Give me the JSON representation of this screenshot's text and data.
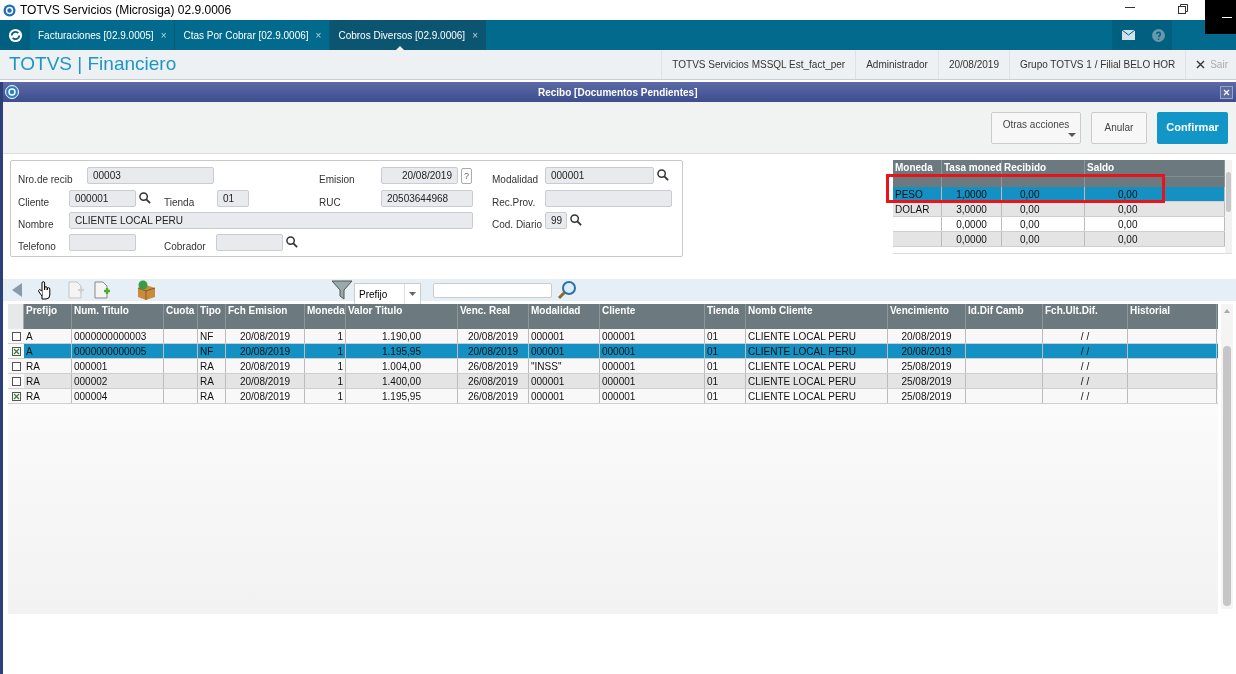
{
  "window": {
    "title": "TOTVS Servicios (Microsiga) 02.9.0006"
  },
  "tabs": [
    {
      "label": "Facturaciones [02.9.0005]",
      "close": "×",
      "selected": false
    },
    {
      "label": "Ctas Por Cobrar [02.9.0006]",
      "close": "×",
      "selected": false
    },
    {
      "label": "Cobros Diversos [02.9.0006]",
      "close": "×",
      "selected": true
    }
  ],
  "header": {
    "brand": "TOTVS | Financiero",
    "info": [
      "TOTVS Servicios MSSQL Est_fact_per",
      "Administrador",
      "20/08/2019",
      "Grupo TOTVS 1 / Filial BELO HOR"
    ],
    "exit": "Sair"
  },
  "dialog": {
    "title": "Recibo [Documentos Pendientes]",
    "buttons": [
      {
        "label": "Otras acciones",
        "kind": "menu"
      },
      {
        "label": "Anular",
        "kind": "plain"
      },
      {
        "label": "Confirmar",
        "kind": "primary"
      }
    ]
  },
  "form": {
    "fields": [
      {
        "label": "Nro.de recib",
        "value": "00003",
        "lookup": false
      },
      {
        "label": "Emision",
        "value": "20/08/2019",
        "help": "?",
        "lookup": false
      },
      {
        "label": "Modalidad",
        "value": "000001",
        "lookup": true
      },
      {
        "label": "Cliente",
        "value": "000001",
        "lookup": true
      },
      {
        "label": "Tienda",
        "value": "01",
        "lookup": false
      },
      {
        "label": "RUC",
        "value": "20503644968",
        "lookup": false
      },
      {
        "label": "Rec.Prov.",
        "lookup": false
      },
      {
        "label": "Nombre",
        "value": "CLIENTE LOCAL PERU",
        "lookup": false
      },
      {
        "label": "Cod. Diario",
        "value": "99",
        "lookup": true
      },
      {
        "label": "Telefono",
        "lookup": false
      },
      {
        "label": "Cobrador",
        "lookup": true
      }
    ]
  },
  "currency_table": {
    "columns": [
      "Moneda",
      "Tasa moned",
      "Recibido",
      "Saldo"
    ],
    "rows": [
      {
        "cells": [
          "PESO",
          "1,0000",
          "0,00",
          "0,00"
        ],
        "selected": true
      },
      {
        "cells": [
          "DOLAR",
          "3,0000",
          "0,00",
          "0,00"
        ],
        "selected": false
      },
      {
        "cells": [
          null,
          "0,0000",
          "0,00",
          "0,00"
        ],
        "selected": false
      },
      {
        "cells": [
          null,
          "0,0000",
          "0,00",
          "0,00"
        ],
        "selected": false
      }
    ]
  },
  "toolbar": {
    "filter_field": "Prefijo"
  },
  "table": {
    "columns": [
      "Prefijo",
      "Num. Titulo",
      "Cuota",
      "Tipo",
      "Fch Emision",
      "Moneda",
      "Valor Titulo",
      "Venc. Real",
      "Modalidad",
      "Cliente",
      "Tienda",
      "Nomb Cliente",
      "Vencimiento",
      "Id.Dif Camb",
      "Fch.Ult.Dif.",
      "Historial"
    ],
    "rows": [
      {
        "checked": false,
        "selected": false,
        "cells": [
          "A",
          "0000000000003",
          null,
          "NF",
          "20/08/2019",
          "1",
          "1.190,00",
          "20/08/2019",
          "000001",
          "000001",
          "01",
          "CLIENTE LOCAL PERU",
          "20/08/2019",
          null,
          "/ /",
          null
        ]
      },
      {
        "checked": true,
        "selected": true,
        "cells": [
          "A",
          "0000000000005",
          null,
          "NF",
          "20/08/2019",
          "1",
          "1.195,95",
          "20/08/2019",
          "000001",
          "000001",
          "01",
          "CLIENTE LOCAL PERU",
          "20/08/2019",
          null,
          "/ /",
          null
        ]
      },
      {
        "checked": false,
        "selected": false,
        "cells": [
          "RA",
          "000001",
          null,
          "RA",
          "20/08/2019",
          "1",
          "1.004,00",
          "26/08/2019",
          "\"INSS\"",
          "000001",
          "01",
          "CLIENTE LOCAL PERU",
          "25/08/2019",
          null,
          "/ /",
          null
        ]
      },
      {
        "checked": false,
        "selected": false,
        "cells": [
          "RA",
          "000002",
          null,
          "RA",
          "20/08/2019",
          "1",
          "1.400,00",
          "26/08/2019",
          "000001",
          "000001",
          "01",
          "CLIENTE LOCAL PERU",
          "25/08/2019",
          null,
          "/ /",
          null
        ]
      },
      {
        "checked": true,
        "selected": false,
        "cells": [
          "RA",
          "000004",
          null,
          "RA",
          "20/08/2019",
          "1",
          "1.195,95",
          "26/08/2019",
          "000001",
          "000001",
          "01",
          "CLIENTE LOCAL PERU",
          "25/08/2019",
          null,
          "/ /",
          null
        ]
      }
    ]
  }
}
